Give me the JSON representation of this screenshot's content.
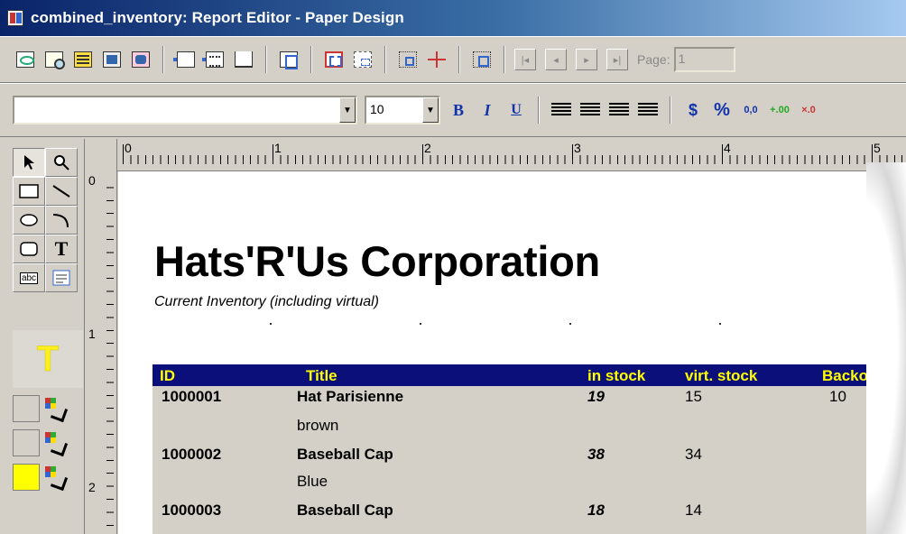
{
  "window": {
    "title": "combined_inventory: Report Editor - Paper Design"
  },
  "toolbar_top": {
    "page_label": "Page:",
    "page_value": "1"
  },
  "toolbar_format": {
    "font_name": "",
    "font_size": "10",
    "bold_label": "B",
    "italic_label": "I",
    "underline_label": "U",
    "currency_label": "$",
    "percent_label": "%",
    "decimal_label": "0,0",
    "add_decimal_label": "+.00",
    "remove_decimal_label": "×.0"
  },
  "palette": {
    "text_tool_label": "T",
    "label_tool_label": "abc",
    "big_text_label": "T",
    "swatch_colors": [
      "#d4d0c8",
      "#d4d0c8",
      "#ffff00"
    ]
  },
  "rulers": {
    "horizontal": [
      "0",
      "1",
      "2",
      "3",
      "4",
      "5"
    ],
    "vertical": [
      "0",
      "1",
      "2"
    ]
  },
  "report": {
    "company": "Hats'R'Us Corporation",
    "subtitle": "Current Inventory (including virtual)",
    "header_bg": "#0b0f7a",
    "header_fg": "#ffff00",
    "columns": [
      "ID",
      "Title",
      "in stock",
      "virt. stock",
      "Backord"
    ],
    "rows": [
      {
        "id": "1000001",
        "title": "Hat Parisienne",
        "detail": "brown",
        "in_stock": "19",
        "virt_stock": "15",
        "backorder": "10"
      },
      {
        "id": "1000002",
        "title": "Baseball Cap",
        "detail": "Blue",
        "in_stock": "38",
        "virt_stock": "34",
        "backorder": ""
      },
      {
        "id": "1000003",
        "title": "Baseball Cap",
        "detail": "",
        "in_stock": "18",
        "virt_stock": "14",
        "backorder": ""
      }
    ]
  }
}
